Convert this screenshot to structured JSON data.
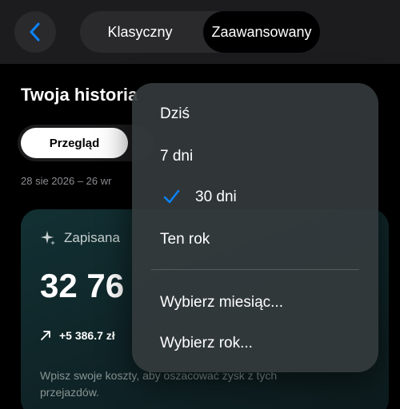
{
  "header": {
    "segments": [
      "Klasyczny",
      "Zaawansowany"
    ],
    "selected_segment": "Zaawansowany"
  },
  "page": {
    "title": "Twoja historia",
    "active_tab": "Przegląd",
    "date_range": "28 sie 2026 – 26 wr"
  },
  "card": {
    "label": "Zapisana",
    "value": "32 76",
    "delta": "+5 386.7 zł",
    "hint": "Wpisz swoje koszty, aby oszacować zysk z tych przejazdów."
  },
  "menu": {
    "items": [
      {
        "label": "Dziś",
        "selected": false
      },
      {
        "label": "7 dni",
        "selected": false
      },
      {
        "label": "30 dni",
        "selected": true
      },
      {
        "label": "Ten rok",
        "selected": false
      }
    ],
    "extra_items": [
      {
        "label": "Wybierz miesiąc..."
      },
      {
        "label": "Wybierz rok..."
      }
    ]
  },
  "colors": {
    "accent": "#0a84ff",
    "background": "#000000",
    "card": "#123033"
  },
  "icons": {
    "back": "chevron-left-icon",
    "sparkle": "sparkle-icon",
    "trend": "arrow-up-right-icon",
    "check": "checkmark-icon"
  }
}
